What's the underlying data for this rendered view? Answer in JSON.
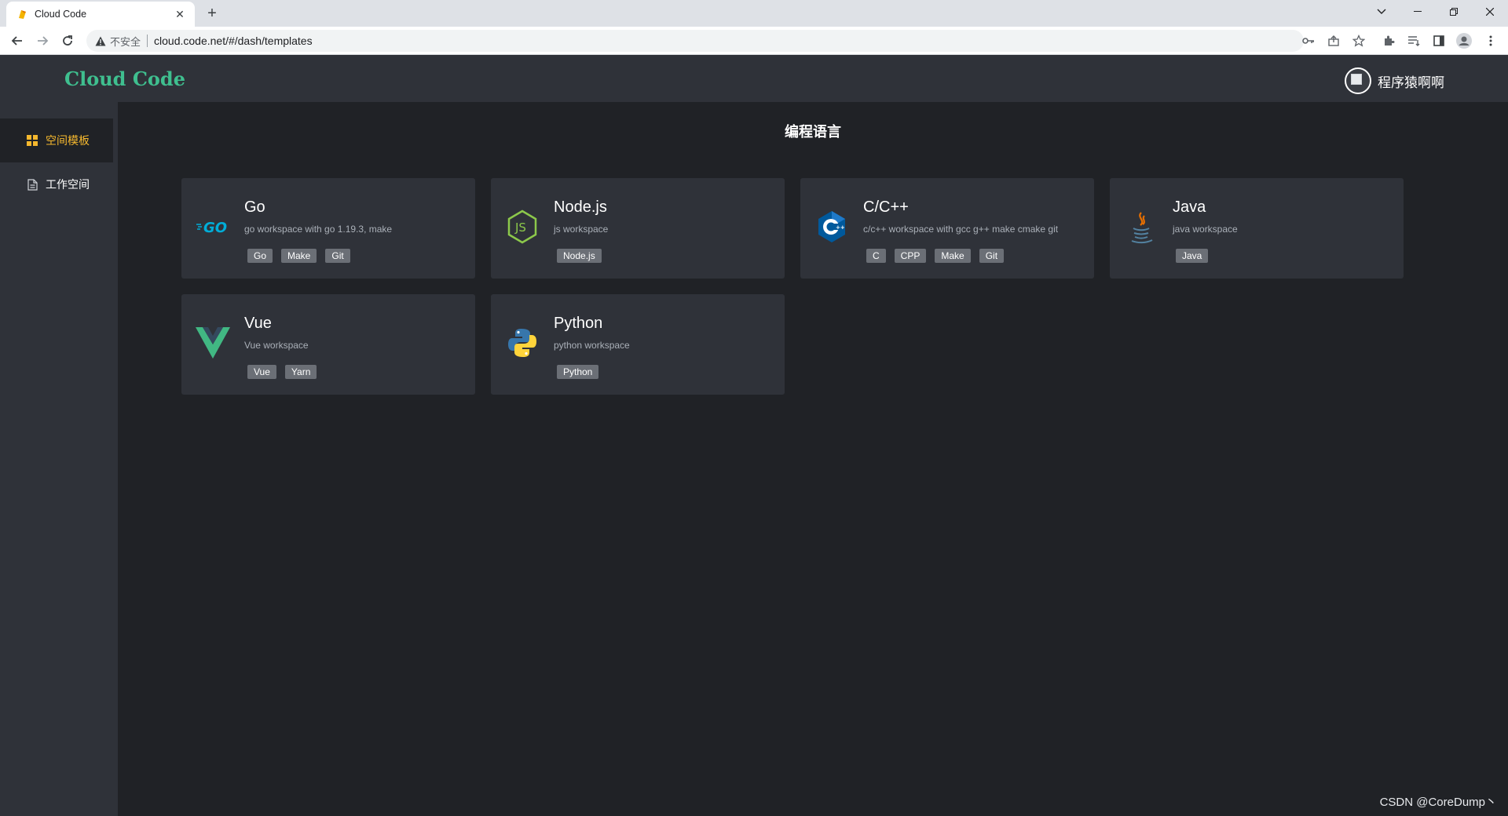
{
  "browser": {
    "tab_title": "Cloud Code",
    "new_tab": "+",
    "close_tab": "✕",
    "insecure_label": "不安全",
    "url": "cloud.code.net/#/dash/templates"
  },
  "header": {
    "brand": "Cloud Code",
    "username": "程序猿啊啊"
  },
  "sidebar": {
    "items": [
      {
        "label": "空间模板",
        "icon": "grid-icon",
        "active": true
      },
      {
        "label": "工作空间",
        "icon": "document-icon",
        "active": false
      }
    ]
  },
  "main": {
    "section_title": "编程语言",
    "cards": [
      {
        "name": "Go",
        "desc": "go workspace with go 1.19.3, make",
        "tags": [
          "Go",
          "Make",
          "Git"
        ],
        "logo": "go-logo"
      },
      {
        "name": "Node.js",
        "desc": "js workspace",
        "tags": [
          "Node.js"
        ],
        "logo": "nodejs-logo"
      },
      {
        "name": "C/C++",
        "desc": "c/c++ workspace with gcc g++ make cmake git",
        "tags": [
          "C",
          "CPP",
          "Make",
          "Git"
        ],
        "logo": "cpp-logo"
      },
      {
        "name": "Java",
        "desc": "java workspace",
        "tags": [
          "Java"
        ],
        "logo": "java-logo"
      },
      {
        "name": "Vue",
        "desc": "Vue workspace",
        "tags": [
          "Vue",
          "Yarn"
        ],
        "logo": "vue-logo"
      },
      {
        "name": "Python",
        "desc": "python workspace",
        "tags": [
          "Python"
        ],
        "logo": "python-logo"
      }
    ]
  },
  "watermark": "CSDN @CoreDump丶",
  "colors": {
    "brand": "#3fbf8f",
    "active_nav": "#f5b82e",
    "card_bg": "#2f3239",
    "page_bg": "#202226"
  }
}
